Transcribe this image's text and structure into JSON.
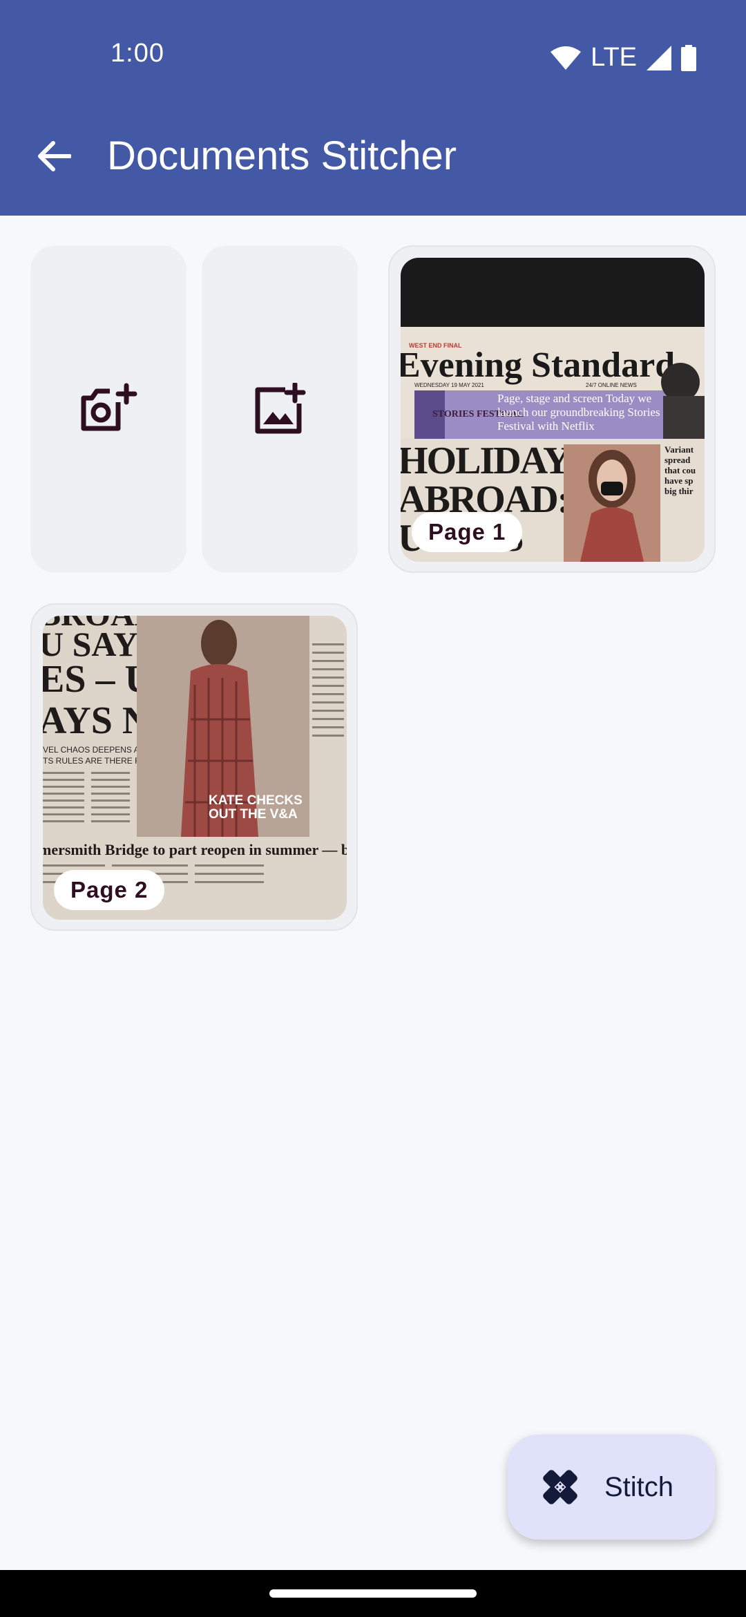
{
  "status": {
    "time": "1:00",
    "network": "LTE"
  },
  "appbar": {
    "title": "Documents Stitcher"
  },
  "tiles": {
    "add_camera_icon": "add-a-photo-icon",
    "add_gallery_icon": "add-photo-alternate-icon"
  },
  "pages": [
    {
      "label": "Page 1",
      "masthead": "Evening Standard",
      "banner_top": "WEST END FINAL",
      "banner": "Page, stage and screen Today we launch our groundbreaking Stories Festival with Netflix",
      "festival": "STORIES FESTIVAL",
      "date": "WEDNESDAY 19 MAY 2021",
      "online": "24/7 ONLINE NEWS",
      "headline": "HOLIDAYS ABROAD: U SAYS",
      "side": "Variant spread that cou have sp big thir"
    },
    {
      "label": "Page 2",
      "headline1": "BROAD:",
      "headline2": "U SAYS",
      "headline3": "ES – UK",
      "headline4": "AYS NO",
      "sub1": "VEL CHAOS DEEPENS AS MINISTER",
      "sub2": "TS RULES ARE THERE FOR GUIDANCE",
      "kate": "KATE CHECKS OUT THE V&A",
      "footer": "mersmith Bridge to part reopen in summer — but no"
    }
  ],
  "fab": {
    "label": "Stitch",
    "icon": "healing-icon"
  },
  "colors": {
    "appbar": "#4359a6",
    "fab": "#dfe2f9",
    "icon": "#2d0f21"
  }
}
